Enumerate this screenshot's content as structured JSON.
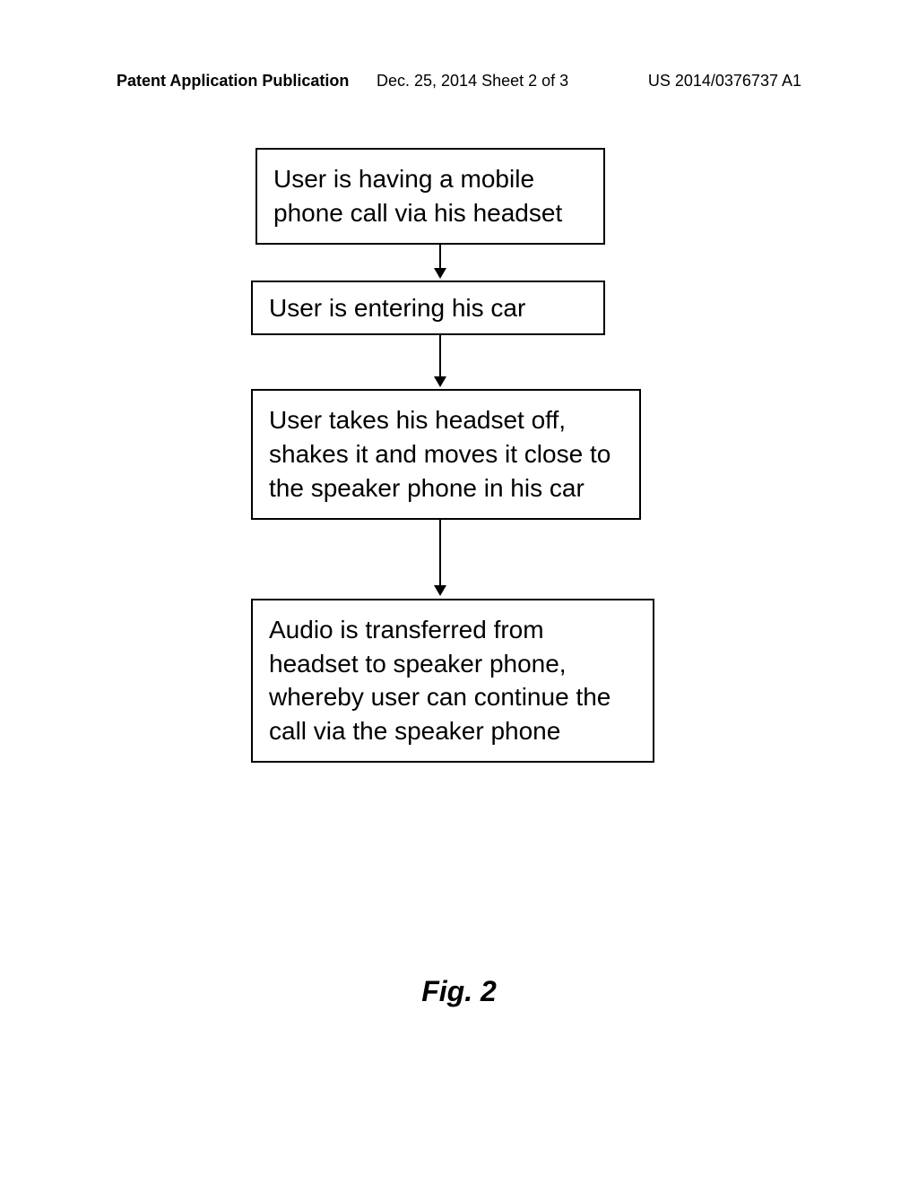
{
  "header": {
    "left": "Patent Application Publication",
    "center": "Dec. 25, 2014  Sheet 2 of 3",
    "right": "US 2014/0376737 A1"
  },
  "flowchart": {
    "steps": [
      "User is having a mobile phone call via his headset",
      "User is entering his car",
      "User takes his headset off, shakes it and moves it close to the speaker phone in his car",
      "Audio is transferred from headset to speaker phone, whereby user can continue the call via the speaker phone"
    ]
  },
  "figure_label": "Fig. 2"
}
